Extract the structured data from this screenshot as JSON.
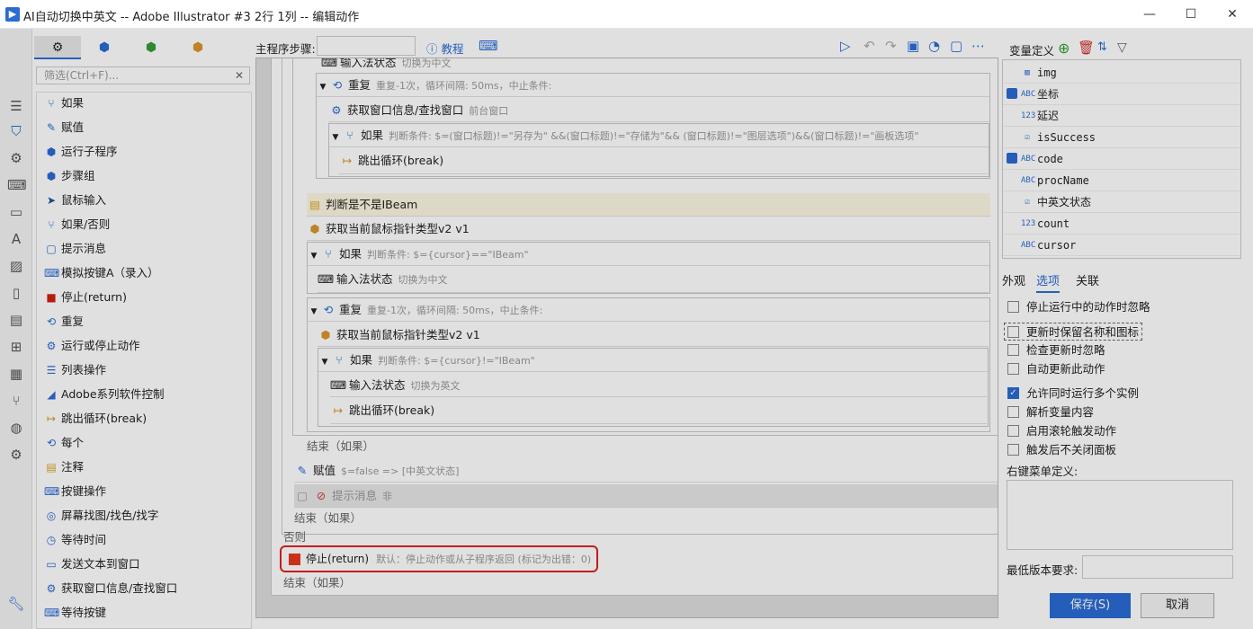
{
  "window": {
    "title": "AI自动切换中英文 -- Adobe Illustrator #3 2行 1列 -- 编辑动作",
    "controls": {
      "minimize": "—",
      "maximize": "☐",
      "close": "✕"
    }
  },
  "left": {
    "filter_placeholder": "筛选(Ctrl+F)...",
    "filter_clear": "✕",
    "items": [
      {
        "label": "如果",
        "icon": "branch-icon"
      },
      {
        "label": "赋值",
        "icon": "edit-icon"
      },
      {
        "label": "运行子程序",
        "icon": "subprogram-icon"
      },
      {
        "label": "步骤组",
        "icon": "group-icon"
      },
      {
        "label": "鼠标输入",
        "icon": "cursor-icon"
      },
      {
        "label": "如果/否则",
        "icon": "branch-else-icon"
      },
      {
        "label": "提示消息",
        "icon": "message-icon"
      },
      {
        "label": "模拟按键A（录入）",
        "icon": "keyboard-icon"
      },
      {
        "label": "停止(return)",
        "icon": "stop-icon"
      },
      {
        "label": "重复",
        "icon": "repeat-icon"
      },
      {
        "label": "运行或停止动作",
        "icon": "gear-icon"
      },
      {
        "label": "列表操作",
        "icon": "list-icon"
      },
      {
        "label": "Adobe系列软件控制",
        "icon": "adobe-icon"
      },
      {
        "label": "跳出循环(break)",
        "icon": "break-icon"
      },
      {
        "label": "每个",
        "icon": "foreach-icon"
      },
      {
        "label": "注释",
        "icon": "note-icon"
      },
      {
        "label": "按键操作",
        "icon": "keyboard-icon"
      },
      {
        "label": "屏幕找图/找色/找字",
        "icon": "find-image-icon"
      },
      {
        "label": "等待时间",
        "icon": "timer-icon"
      },
      {
        "label": "发送文本到窗口",
        "icon": "send-text-icon"
      },
      {
        "label": "获取窗口信息/查找窗口",
        "icon": "gear-icon"
      },
      {
        "label": "等待按键",
        "icon": "keyboard-icon"
      }
    ]
  },
  "stepbar": {
    "label": "主程序步骤:",
    "help": "ⓘ 教程"
  },
  "canvas": {
    "r_ime_top": {
      "label": "输入法状态",
      "detail": "切换为中文"
    },
    "r_repeat1": {
      "label": "重复",
      "detail": "重复-1次，循环间隔: 50ms，中止条件:"
    },
    "r_getwin": {
      "label": "获取窗口信息/查找窗口",
      "detail": "前台窗口"
    },
    "r_if1": {
      "label": "如果",
      "detail": "判断条件: $=(窗口标题)!=\"另存为\" &&(窗口标题)!=\"存储为\"&& (窗口标题)!=\"图层选项\")&&(窗口标题)!=\"画板选项\""
    },
    "r_break1": {
      "label": "跳出循环(break)"
    },
    "r_note": {
      "label": "判断是不是IBeam"
    },
    "r_getcursor1": {
      "label": "获取当前鼠标指针类型v2 v1"
    },
    "r_if2": {
      "label": "如果",
      "detail": "判断条件: $={cursor}==\"IBeam\""
    },
    "r_ime_cn": {
      "label": "输入法状态",
      "detail": "切换为中文"
    },
    "r_repeat2": {
      "label": "重复",
      "detail": "重复-1次，循环间隔: 50ms，中止条件:"
    },
    "r_getcursor2": {
      "label": "获取当前鼠标指针类型v2 v1"
    },
    "r_if3": {
      "label": "如果",
      "detail": "判断条件: $={cursor}!=\"IBeam\""
    },
    "r_ime_en": {
      "label": "输入法状态",
      "detail": "切换为英文"
    },
    "r_break2": {
      "label": "跳出循环(break)"
    },
    "end_if_a": "结束（如果）",
    "r_assign": {
      "label": "赋值",
      "detail": "$=false => [中英文状态]"
    },
    "r_msg": {
      "label": "提示消息",
      "detail": "非"
    },
    "end_if_b": "结束（如果）",
    "else": "否则",
    "stop": {
      "label": "停止(return)",
      "detail": "默认：停止动作或从子程序返回 (标记为出错：0)"
    },
    "end_if_c": "结束（如果）"
  },
  "vars": {
    "title": "变量定义",
    "items": [
      {
        "name": "img",
        "type": "IMG",
        "locked": false
      },
      {
        "name": "坐标",
        "type": "ABC",
        "locked": true
      },
      {
        "name": "延迟",
        "type": "123",
        "locked": false
      },
      {
        "name": "isSuccess",
        "type": "☑",
        "locked": false
      },
      {
        "name": "code",
        "type": "ABC",
        "locked": true
      },
      {
        "name": "procName",
        "type": "ABC",
        "locked": false
      },
      {
        "name": "中英文状态",
        "type": "☑",
        "locked": false
      },
      {
        "name": "count",
        "type": "123",
        "locked": false
      },
      {
        "name": "cursor",
        "type": "ABC",
        "locked": false
      }
    ]
  },
  "props": {
    "tabs": [
      "外观",
      "选项",
      "关联"
    ],
    "options": [
      {
        "label": "停止运行中的动作时忽略",
        "checked": false
      },
      {
        "label": "更新时保留名称和图标",
        "checked": false
      },
      {
        "label": "检查更新时忽略",
        "checked": false
      },
      {
        "label": "自动更新此动作",
        "checked": false
      },
      {
        "label": "允许同时运行多个实例",
        "checked": true
      },
      {
        "label": "解析变量内容",
        "checked": false
      },
      {
        "label": "启用滚轮触发动作",
        "checked": false
      },
      {
        "label": "触发后不关闭面板",
        "checked": false
      }
    ],
    "ctx_label": "右键菜单定义:",
    "min_version_label": "最低版本要求:",
    "save": "保存(S)",
    "cancel": "取消"
  }
}
